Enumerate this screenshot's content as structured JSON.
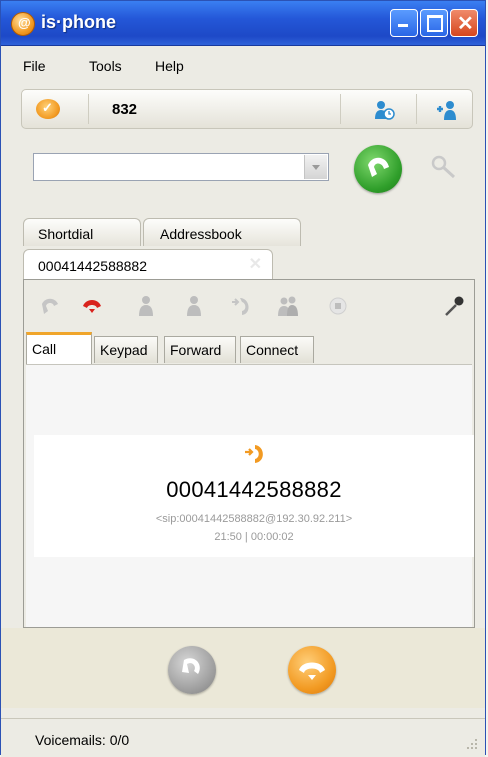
{
  "window": {
    "title": "is·phone",
    "colors": {
      "titlebar": "#2457d8",
      "accent": "#f29a22",
      "call_green": "#2f9e2a"
    }
  },
  "menu": [
    "File",
    "Tools",
    "Help"
  ],
  "toolbar": {
    "status_icon": "presence-available-icon",
    "extension": "832",
    "history_icon": "call-history-icon",
    "add_contact_icon": "add-contact-icon"
  },
  "dialer": {
    "input_value": "",
    "call_icon": "phone-call-icon",
    "search_icon": "search-icon"
  },
  "tabs": {
    "top": [
      "Shortdial",
      "Addressbook"
    ],
    "session": "00041442588882"
  },
  "call_toolbar_icons": [
    "answer-icon",
    "hangup-icon",
    "hold-icon",
    "transfer-icon",
    "callback-icon",
    "conference-icon",
    "record-icon",
    "microphone-icon"
  ],
  "subtabs": [
    "Call",
    "Keypad",
    "Forward",
    "Connect"
  ],
  "call": {
    "direction_icon": "outgoing-call-icon",
    "number": "00041442588882",
    "sip": "<sip:00041442588882@192.30.92.211>",
    "time": "21:50 | 00:00:02"
  },
  "status": {
    "voicemails": "Voicemails: 0/0"
  }
}
